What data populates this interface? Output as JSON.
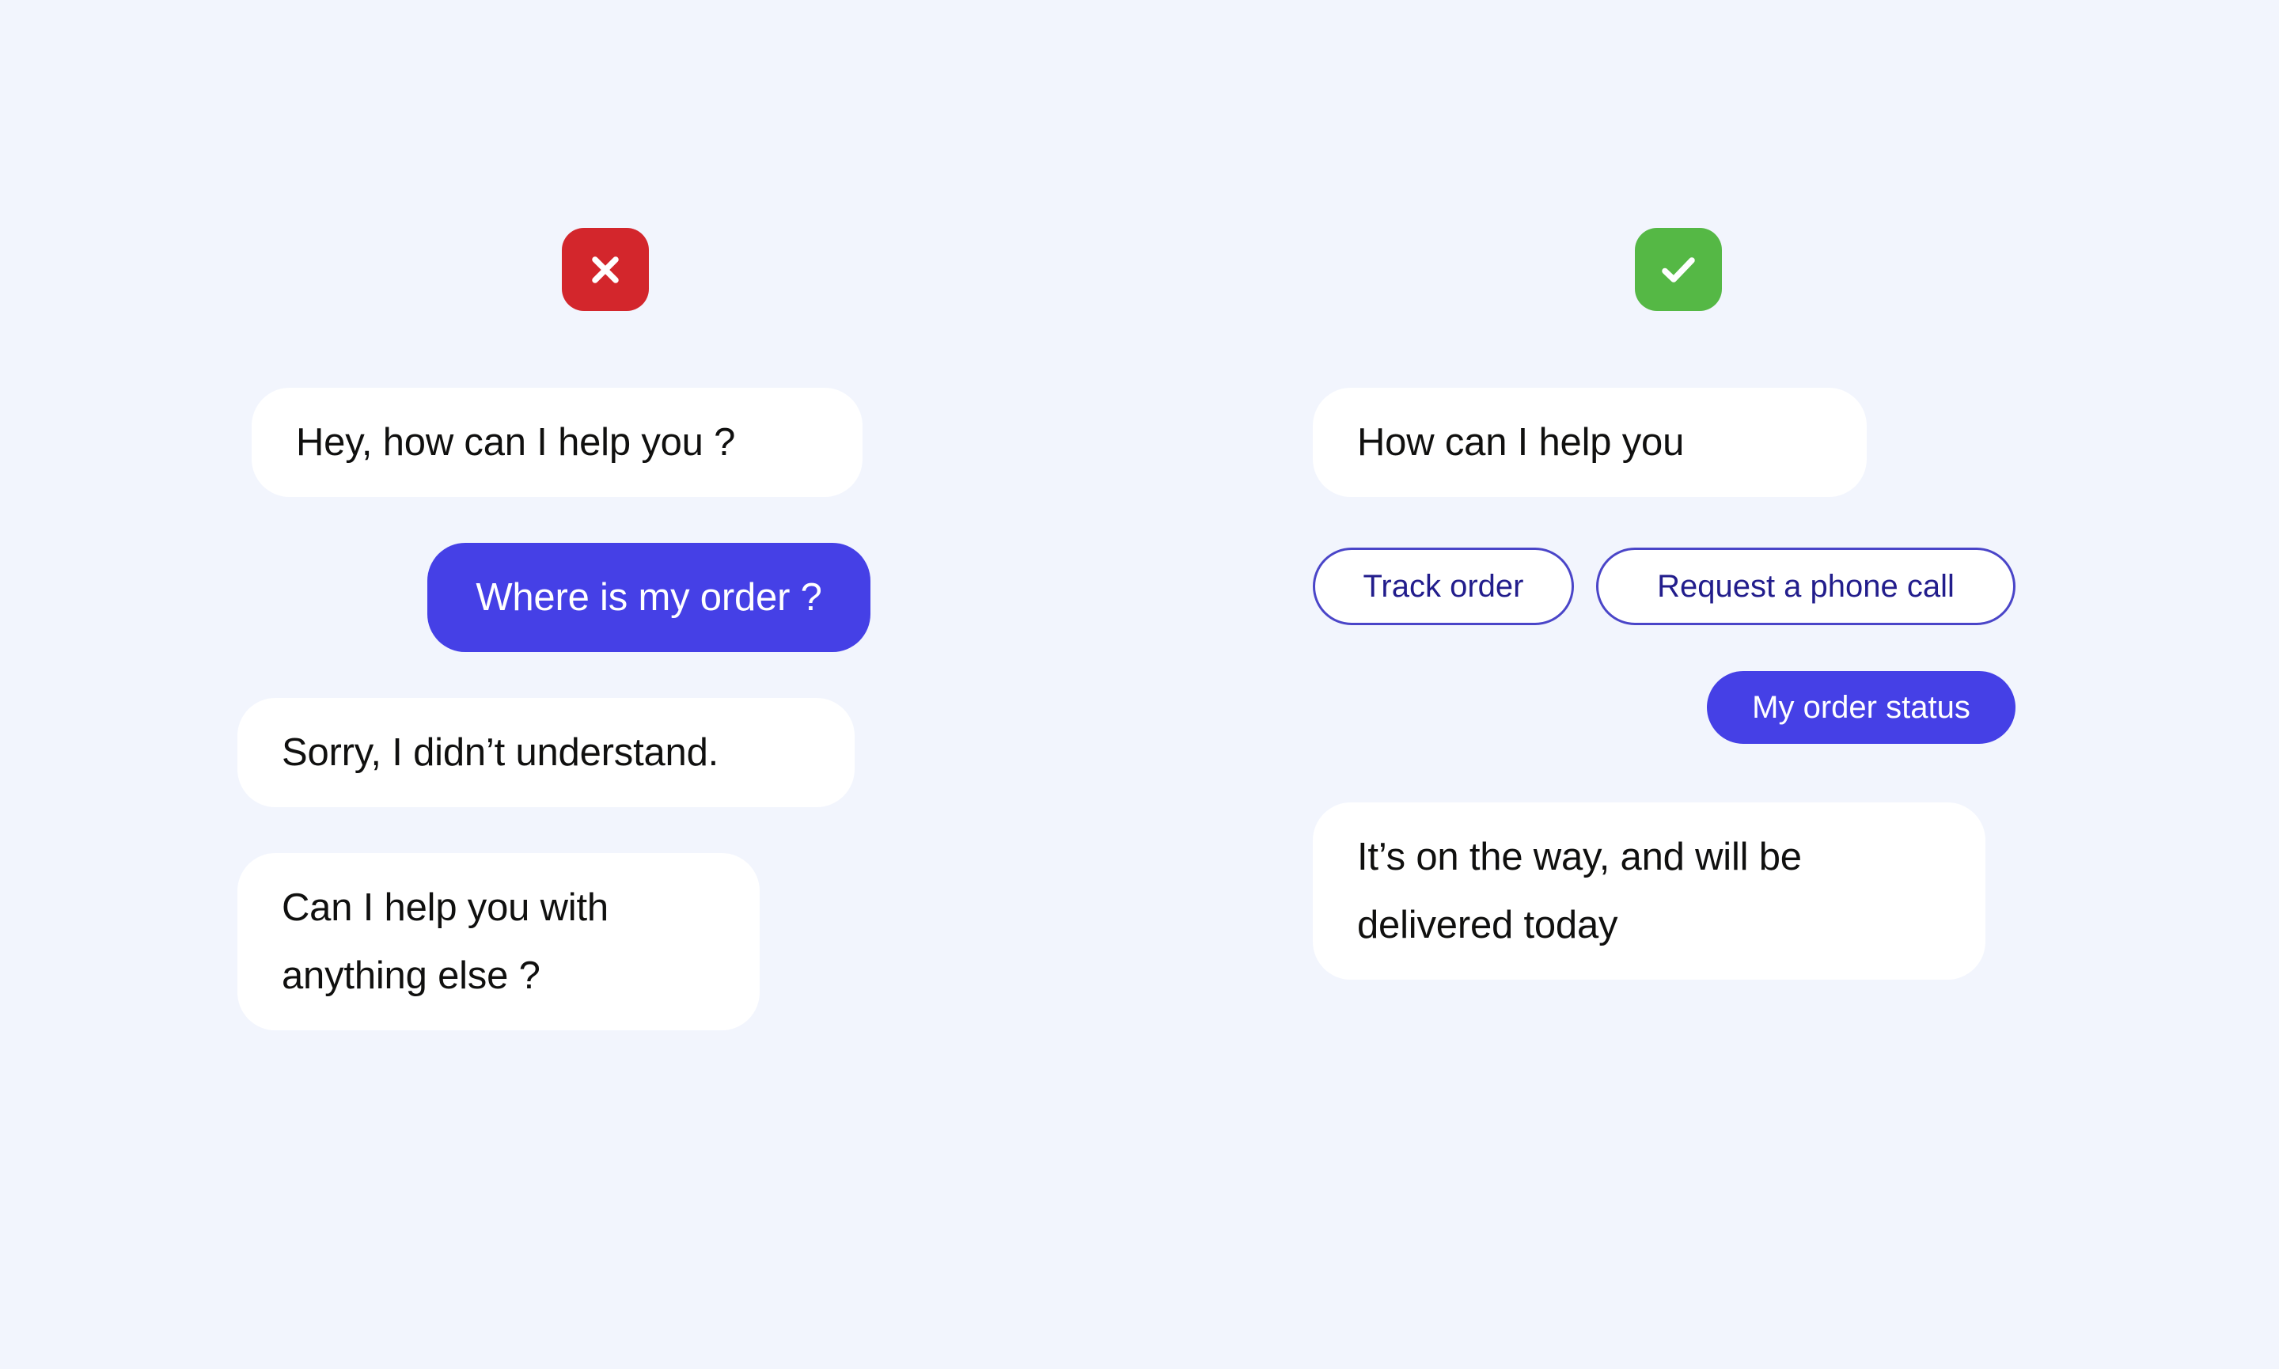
{
  "theme": {
    "background": "#f2f5fd",
    "bubble_bot_bg": "#ffffff",
    "bubble_bot_text": "#10100f",
    "accent_blue": "#4540e6",
    "chip_border": "#4a45c8",
    "chip_text": "#221d8c",
    "badge_error": "#d3262c",
    "badge_success": "#55b845"
  },
  "columns": [
    {
      "id": "bad-example",
      "badge": {
        "icon": "close-icon",
        "kind": "error",
        "color": "#d3262c"
      },
      "messages": [
        {
          "id": "bot-greeting",
          "role": "bot",
          "text": "Hey, how can I help you ?"
        },
        {
          "id": "user-question",
          "role": "user",
          "text": "Where is my order ?"
        },
        {
          "id": "bot-fallback",
          "role": "bot",
          "text": "Sorry, I didn’t understand."
        },
        {
          "id": "bot-followup",
          "role": "bot",
          "text": "Can I help you with\nanything else ?"
        }
      ]
    },
    {
      "id": "good-example",
      "badge": {
        "icon": "check-icon",
        "kind": "success",
        "color": "#55b845"
      },
      "messages": [
        {
          "id": "bot-greeting",
          "role": "bot",
          "text": "How can I help you"
        },
        {
          "id": "bot-answer",
          "role": "bot",
          "text": "It’s on the way, and will be\ndelivered today"
        }
      ],
      "quick_replies": [
        {
          "id": "track-order",
          "label": "Track order",
          "style": "outline"
        },
        {
          "id": "request-a-phone-call",
          "label": "Request a phone call",
          "style": "outline"
        },
        {
          "id": "my-order-status",
          "label": "My order status",
          "style": "filled"
        }
      ]
    }
  ]
}
